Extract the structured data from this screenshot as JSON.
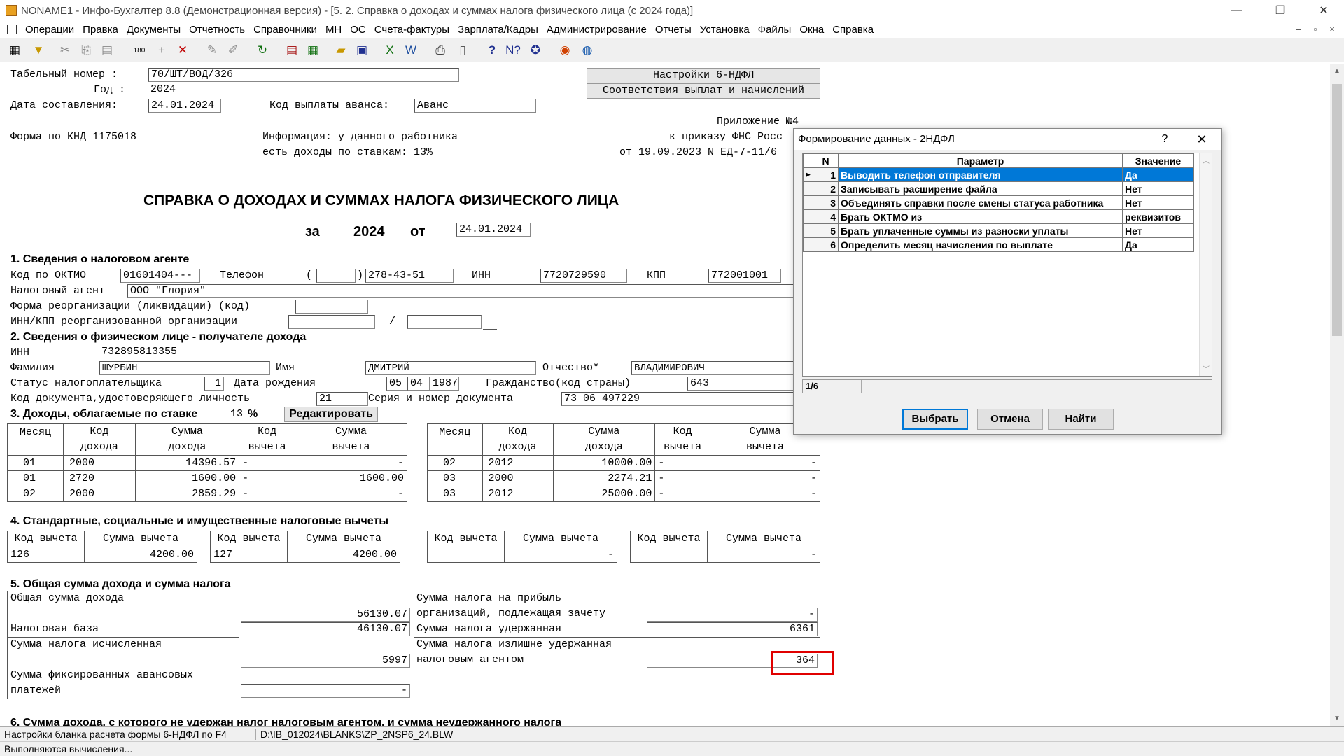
{
  "window": {
    "title": "NONAME1 - Инфо-Бухгалтер 8.8 (Демонстрационная версия) - [5.  2. Справка о доходах и суммах налога физического лица (с 2024 года)]",
    "minimize": "—",
    "restore": "❐",
    "close": "✕"
  },
  "menu": [
    "Операции",
    "Правка",
    "Документы",
    "Отчетность",
    "Справочники",
    "МН",
    "ОС",
    "Счета-фактуры",
    "Зарплата/Кадры",
    "Администрирование",
    "Отчеты",
    "Установка",
    "Файлы",
    "Окна",
    "Справка"
  ],
  "toolbar_icons": [
    "table-icon",
    "filter-icon",
    "cut-icon",
    "copy-icon",
    "paste-icon",
    "counter-icon",
    "plus-icon",
    "delete-icon",
    "pick-icon",
    "pick-all-icon",
    "refresh-icon",
    "report-icon",
    "calculator-icon",
    "open-folder-icon",
    "save-icon",
    "excel-icon",
    "word-icon",
    "print-icon",
    "preview-icon",
    "help-icon",
    "context-help-icon",
    "compass-icon",
    "lifebuoy-icon",
    "globe-icon"
  ],
  "header": {
    "tab_label": "Табельный номер :",
    "tab_value": "70/ШТ/ВОД/326",
    "year_label": "Год :",
    "year_value": "2024",
    "date_label": "Дата составления:",
    "date_value": "24.01.2024",
    "advance_label": "Код выплаты аванса:",
    "advance_value": "Аванс",
    "settings_btn": "Настройки 6-НДФЛ",
    "match_btn": "Соответствия выплат и начислений",
    "appendix": "Приложение №4",
    "knd": "Форма по КНД 1175018",
    "info1": "Информация: у данного работника",
    "info2": "есть доходы по ставкам: 13%",
    "order1": "к приказу ФНС Росс",
    "order2": "от 19.09.2023 N ЕД-7-11/6"
  },
  "doc": {
    "title": "СПРАВКА О ДОХОДАХ И СУММАХ НАЛОГА ФИЗИЧЕСКОГО ЛИЦА",
    "for_label": "за",
    "year": "2024",
    "from_label": "от",
    "date": "24.01.2024"
  },
  "s1": {
    "title": "1. Сведения о налоговом агенте",
    "oktmo_label": "Код по ОКТМО",
    "oktmo": "01601404---",
    "phone_label": "Телефон",
    "phone_open": "(",
    "phone_code": "",
    "phone_close": ")",
    "phone": "278-43-51",
    "inn_label": "ИНН",
    "inn": "7720729590",
    "kpp_label": "КПП",
    "kpp": "772001001",
    "agent_label": "Налоговый агент",
    "agent": "ООО \"Глория\"",
    "reorg_label": "Форма реорганизации (ликвидации) (код)",
    "reorg": "",
    "reorg_inn_label": "ИНН/КПП реорганизованной организации",
    "slash": "/"
  },
  "s2": {
    "title": "2. Сведения о физическом лице - получателе дохода",
    "inn_label": "ИНН",
    "inn": "732895813355",
    "last_label": "Фамилия",
    "last": "ШУРБИН",
    "first_label": "Имя",
    "first": "ДМИТРИЙ",
    "middle_label": "Отчество*",
    "middle": "ВЛАДИМИРОВИЧ",
    "status_label": "Статус налогоплательщика",
    "status": "1",
    "birth_label": "Дата рождения",
    "birth_d": "05",
    "birth_m": "04",
    "birth_y": "1987",
    "citizen_label": "Гражданство(код страны)",
    "citizen": "643",
    "doc_label": "Код документа,удостоверяющего личность",
    "doc_code": "21",
    "series_label": "Серия и номер документа",
    "series": "73 06 497229"
  },
  "s3": {
    "title": "3. Доходы, облагаемые по ставке",
    "rate": "13",
    "pct": "%",
    "edit_btn": "Редактировать",
    "headers": [
      [
        "Месяц",
        ""
      ],
      [
        "Код",
        "дохода"
      ],
      [
        "Сумма",
        "дохода"
      ],
      [
        "Код",
        "вычета"
      ],
      [
        "Сумма",
        "вычета"
      ]
    ],
    "left_rows": [
      [
        "01",
        "2000",
        "14396.57",
        "-",
        "-"
      ],
      [
        "01",
        "2720",
        "1600.00",
        "-",
        "1600.00"
      ],
      [
        "02",
        "2000",
        "2859.29",
        "-",
        "-"
      ]
    ],
    "right_rows": [
      [
        "02",
        "2012",
        "10000.00",
        "-",
        "-"
      ],
      [
        "03",
        "2000",
        "2274.21",
        "-",
        "-"
      ],
      [
        "03",
        "2012",
        "25000.00",
        "-",
        "-"
      ]
    ]
  },
  "s4": {
    "title": "4. Стандартные, социальные и имущественные налоговые вычеты",
    "h_code": "Код вычета",
    "h_sum": "Сумма вычета",
    "items": [
      {
        "code": "126",
        "sum": "4200.00"
      },
      {
        "code": "127",
        "sum": "4200.00"
      },
      {
        "code": "",
        "sum": "-"
      },
      {
        "code": "",
        "sum": "-"
      }
    ]
  },
  "s5": {
    "title": "5. Общая сумма дохода и сумма налога",
    "total_label": "Общая сумма дохода",
    "total": "56130.07",
    "base_label": "Налоговая база",
    "base": "46130.07",
    "calc_label": "Сумма налога исчисленная",
    "calc": "5997",
    "fixed_label1": "Сумма фиксированных авансовых",
    "fixed_label2": "платежей",
    "fixed": "-",
    "profit_label1": "Сумма налога на прибыль",
    "profit_label2": "организаций, подлежащая зачету",
    "profit": "-",
    "withheld_label": "Сумма налога удержанная",
    "withheld": "6361",
    "excess_label1": "Сумма налога излишне удержанная",
    "excess_label2": "налоговым агентом",
    "excess": "364"
  },
  "s6": {
    "title": "6. Сумма дохода, с которого не удержан налог налоговым агентом, и сумма неудержанного налога"
  },
  "status": {
    "left": "Настройки бланка расчета формы 6-НДФЛ по F4",
    "path": "D:\\IB_012024\\BLANKS\\ZP_2NSP6_24.BLW",
    "bottom": "Выполняются вычисления..."
  },
  "dialog": {
    "title": "Формирование данных - 2НДФЛ",
    "help": "?",
    "close": "✕",
    "col_n": "N",
    "col_param": "Параметр",
    "col_value": "Значение",
    "rows": [
      {
        "n": "1",
        "param": "Выводить телефон отправителя",
        "value": "Да"
      },
      {
        "n": "2",
        "param": "Записывать расширение файла",
        "value": "Нет"
      },
      {
        "n": "3",
        "param": "Объединять справки после смены статуса работника",
        "value": "Нет"
      },
      {
        "n": "4",
        "param": "Брать ОКТМО из",
        "value": "реквизитов"
      },
      {
        "n": "5",
        "param": "Брать уплаченные суммы из разноски уплаты",
        "value": "Нет"
      },
      {
        "n": "6",
        "param": "Определить месяц начисления по выплате",
        "value": "Да"
      }
    ],
    "position": "1/6",
    "ok": "Выбрать",
    "cancel": "Отмена",
    "find": "Найти"
  }
}
